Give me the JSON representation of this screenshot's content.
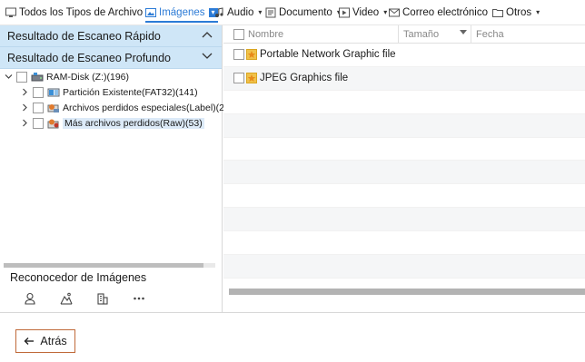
{
  "filters": [
    {
      "label": "Todos los Tipos de Archivo",
      "icon": "monitor-icon",
      "chevron": false,
      "active": false
    },
    {
      "label": "Imágenes",
      "icon": "image-icon",
      "chevron": true,
      "active": true
    },
    {
      "label": "Audio",
      "icon": "music-note-icon",
      "chevron": true,
      "active": false
    },
    {
      "label": "Documento",
      "icon": "document-icon",
      "chevron": true,
      "active": false
    },
    {
      "label": "Video",
      "icon": "video-icon",
      "chevron": true,
      "active": false
    },
    {
      "label": "Correo electrónico",
      "icon": "mail-icon",
      "chevron": true,
      "active": false
    },
    {
      "label": "Otros",
      "icon": "folder-icon",
      "chevron": true,
      "active": false
    }
  ],
  "sidebar": {
    "quick_scan": "Resultado de Escaneo Rápido",
    "deep_scan": "Resultado de Escaneo Profundo",
    "tree": [
      {
        "label": "RAM-Disk (Z:)(196)",
        "icon": "drive-icon",
        "expanded": true,
        "level": 0
      },
      {
        "label": "Partición Existente(FAT32)(141)",
        "icon": "partition-icon",
        "expanded": false,
        "level": 1
      },
      {
        "label": "Archivos perdidos especiales(Label)(2)",
        "icon": "special-files-icon",
        "expanded": false,
        "level": 1
      },
      {
        "label": "Más archivos perdidos(Raw)(53)",
        "icon": "lost-files-icon",
        "expanded": false,
        "level": 1,
        "selected": true
      }
    ],
    "recognizer": {
      "title": "Reconocedor de Imágenes",
      "icons": [
        "person-icon",
        "landscape-icon",
        "building-icon",
        "more-icon"
      ]
    }
  },
  "table": {
    "columns": [
      "Nombre",
      "Tamaño",
      "Fecha"
    ],
    "rows": [
      {
        "name": "Portable Network Graphic file"
      },
      {
        "name": "JPEG Graphics file"
      }
    ]
  },
  "footer": {
    "back_label": "Atrás"
  },
  "colors": {
    "accent": "#2c7bd6",
    "header_bg": "#cfe6f7",
    "back_border": "#c06a3a"
  }
}
